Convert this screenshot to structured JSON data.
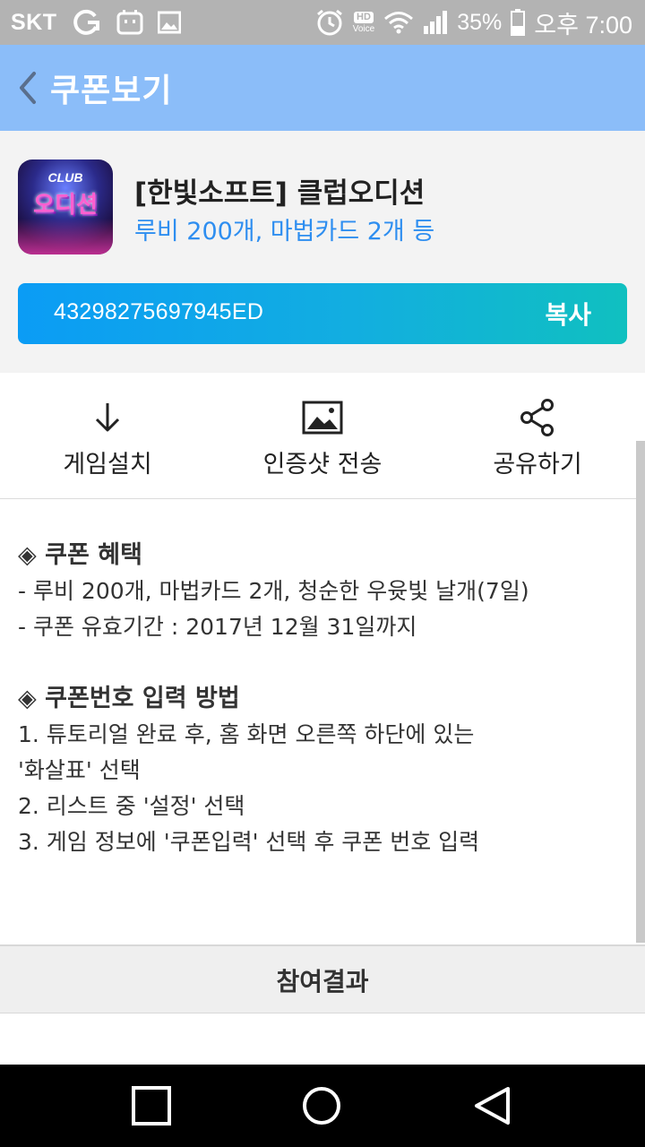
{
  "status_bar": {
    "carrier": "SKT",
    "hd_label": "HD",
    "voice_label": "Voice",
    "battery": "35%",
    "time": "오후 7:00"
  },
  "app_bar": {
    "title": "쿠폰보기"
  },
  "coupon": {
    "game_title": "[한빛소프트] 클럽오디션",
    "reward_summary": "루비 200개, 마법카드 2개 등",
    "code": "43298275697945ED",
    "copy_label": "복사",
    "icon_text_top": "CLUB",
    "icon_text_main": "오디션"
  },
  "actions": {
    "install": "게임설치",
    "screenshot": "인증샷 전송",
    "share": "공유하기"
  },
  "details": {
    "benefit_heading": "◈ 쿠폰 혜택",
    "benefit_line1": "- 루비 200개, 마법카드 2개, 청순한 우윳빛 날개(7일)",
    "benefit_line2": "- 쿠폰 유효기간 : 2017년 12월 31일까지",
    "howto_heading": "◈ 쿠폰번호 입력 방법",
    "howto_line1": "1. 튜토리얼 완료 후, 홈 화면 오른쪽 하단에 있는",
    "howto_line1b": "'화살표' 선택",
    "howto_line2": "2. 리스트 중 '설정' 선택",
    "howto_line3": "3. 게임 정보에 '쿠폰입력' 선택 후 쿠폰 번호 입력"
  },
  "results": {
    "label": "참여결과"
  },
  "colors": {
    "app_bar": "#8bbdf9",
    "accent_blue": "#2e8ef0",
    "code_gradient_start": "#0b9cf5",
    "code_gradient_end": "#10c0c0"
  }
}
